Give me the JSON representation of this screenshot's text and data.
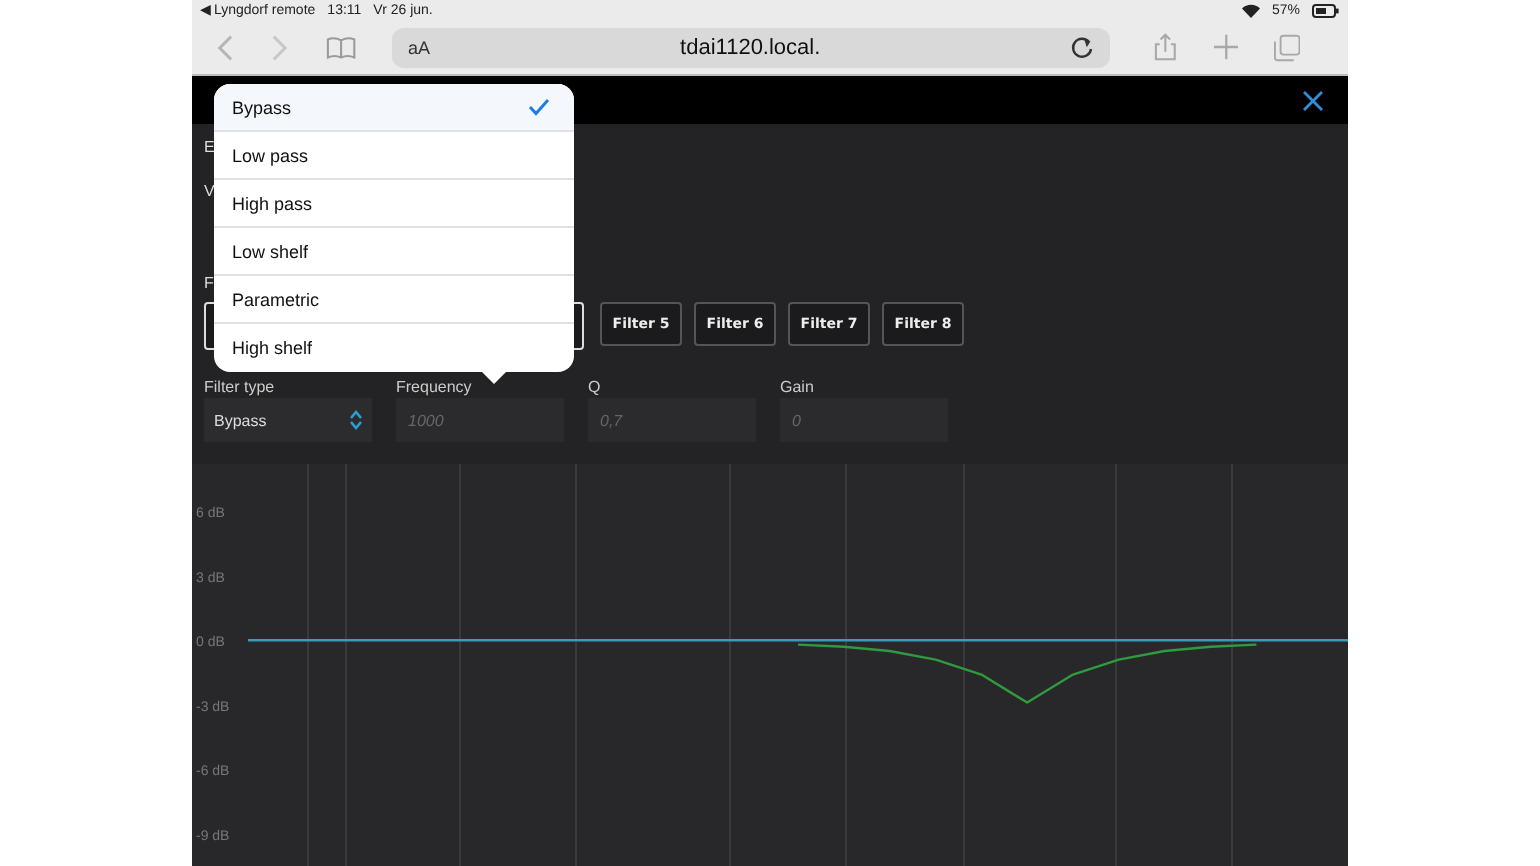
{
  "status_bar": {
    "back_app": "◀ Lyngdorf remote",
    "time": "13:11",
    "date": "Vr 26 jun.",
    "battery": "57%"
  },
  "browser": {
    "text_size": "aA",
    "address": "tdai1120.local."
  },
  "page": {
    "cut_labels": [
      "E",
      "V",
      "F"
    ],
    "filters": [
      "Filter 5",
      "Filter 6",
      "Filter 7",
      "Filter 8"
    ],
    "fields": [
      {
        "label": "Filter type",
        "kind": "select",
        "value": "Bypass"
      },
      {
        "label": "Frequency",
        "kind": "input",
        "placeholder": "1000"
      },
      {
        "label": "Q",
        "kind": "input",
        "placeholder": "0,7"
      },
      {
        "label": "Gain",
        "kind": "input",
        "placeholder": "0"
      }
    ],
    "chart": {
      "chart_data": {
        "type": "line",
        "ylim": [
          -10.5,
          8.2
        ],
        "yticks": [
          {
            "value": 6,
            "label": "6 dB"
          },
          {
            "value": 3,
            "label": "3 dB"
          },
          {
            "value": 0,
            "label": "0 dB"
          },
          {
            "value": -3,
            "label": "-3 dB"
          },
          {
            "value": -6,
            "label": "-6 dB"
          },
          {
            "value": -9,
            "label": "-9 dB"
          }
        ],
        "series": [
          {
            "color": "#2f9a3e",
            "values": [
              null,
              null,
              null,
              null,
              null,
              null,
              null,
              null,
              null,
              null,
              null,
              null,
              -0.2,
              -0.3,
              -0.5,
              -0.9,
              -1.6,
              -2.9,
              -1.6,
              -0.9,
              -0.5,
              -0.3,
              -0.2,
              null,
              null
            ]
          },
          {
            "color": "#3a9ab8",
            "values": [
              0,
              0,
              0,
              0,
              0,
              0,
              0,
              0,
              0,
              0,
              0,
              0,
              0,
              0,
              0,
              0,
              0,
              0,
              0,
              0,
              0,
              0,
              0,
              0,
              0
            ]
          }
        ]
      }
    }
  },
  "popover": {
    "options": [
      {
        "label": "Bypass",
        "selected": true
      },
      {
        "label": "Low pass",
        "selected": false
      },
      {
        "label": "High pass",
        "selected": false
      },
      {
        "label": "Low shelf",
        "selected": false
      },
      {
        "label": "Parametric",
        "selected": false
      },
      {
        "label": "High shelf",
        "selected": false
      }
    ]
  }
}
